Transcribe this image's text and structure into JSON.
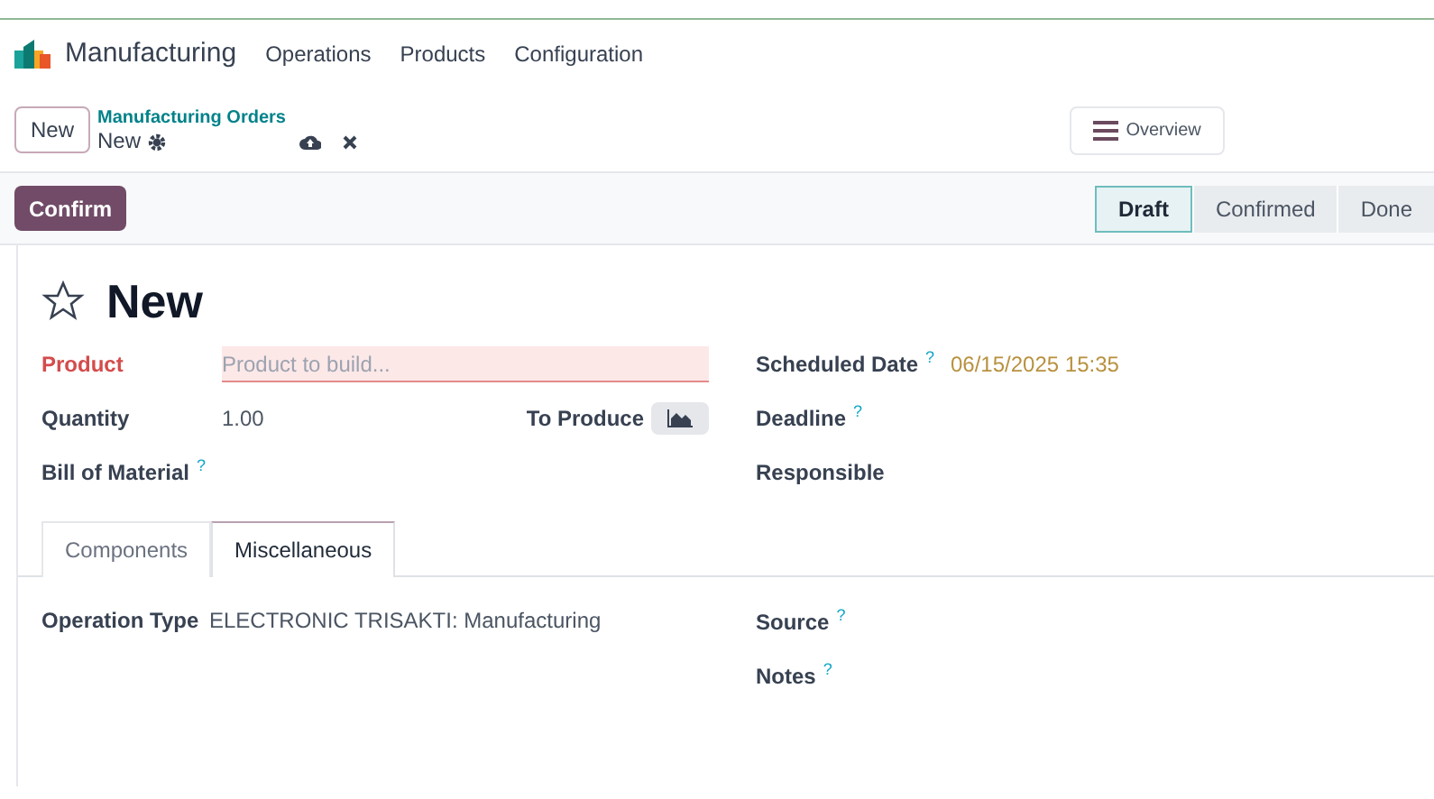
{
  "navbar": {
    "app": "Manufacturing",
    "menu": [
      "Operations",
      "Products",
      "Configuration"
    ]
  },
  "control_panel": {
    "new_button": "New",
    "breadcrumb": "Manufacturing Orders",
    "record": "New",
    "overview_button": "Overview"
  },
  "action_bar": {
    "confirm_button": "Confirm",
    "stages": [
      {
        "label": "Draft",
        "selected": true
      },
      {
        "label": "Confirmed",
        "selected": false
      },
      {
        "label": "Done",
        "selected": false
      }
    ]
  },
  "form": {
    "title": "New",
    "starred": false,
    "left_fields": [
      {
        "label": "Product",
        "kind": "input",
        "placeholder": "Product to build...",
        "required": true
      },
      {
        "label": "Quantity",
        "kind": "quantity",
        "value": "1.00",
        "suffix": "To Produce"
      },
      {
        "label": "Bill of Material",
        "kind": "empty",
        "help": "?"
      }
    ],
    "right_fields": [
      {
        "label": "Scheduled Date",
        "kind": "date",
        "value": "06/15/2025 15:35",
        "help": "?"
      },
      {
        "label": "Deadline",
        "kind": "empty",
        "help": "?"
      },
      {
        "label": "Responsible",
        "kind": "empty"
      }
    ],
    "tabs": [
      {
        "label": "Components",
        "selected": false
      },
      {
        "label": "Miscellaneous",
        "selected": true
      }
    ],
    "misc_left": [
      {
        "label": "Operation Type",
        "value": "ELECTRONIC TRISAKTI: Manufacturing"
      }
    ],
    "misc_right": [
      {
        "label": "Source",
        "help": "?"
      },
      {
        "label": "Notes",
        "help": "?"
      }
    ]
  }
}
